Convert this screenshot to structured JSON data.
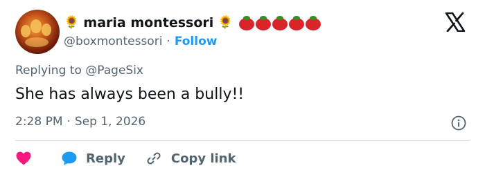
{
  "author": {
    "name": "maria montessori",
    "handle": "@boxmontessori",
    "separator": "·",
    "follow_label": "Follow",
    "name_emoji_before": "🌻",
    "name_emoji_after": "🌻"
  },
  "reply_context": {
    "prefix": "Replying to",
    "mention": "@PageSix"
  },
  "tweet": {
    "text": "She has always been a bully!!",
    "time": "2:28 PM",
    "separator": "·",
    "date": "Sep 1, 2026"
  },
  "actions": {
    "reply_label": "Reply",
    "copy_link_label": "Copy link"
  },
  "icons": {
    "logo": "x-logo-icon",
    "info": "info-icon",
    "like": "heart-icon",
    "reply": "reply-bubble-icon",
    "copy": "link-icon",
    "status_emoji": "tomato-icon"
  },
  "colors": {
    "accent": "#1d9bf0",
    "secondary_text": "#536471",
    "primary_text": "#0f1419",
    "heart": "#f91880",
    "tomato": "#d9242b"
  }
}
